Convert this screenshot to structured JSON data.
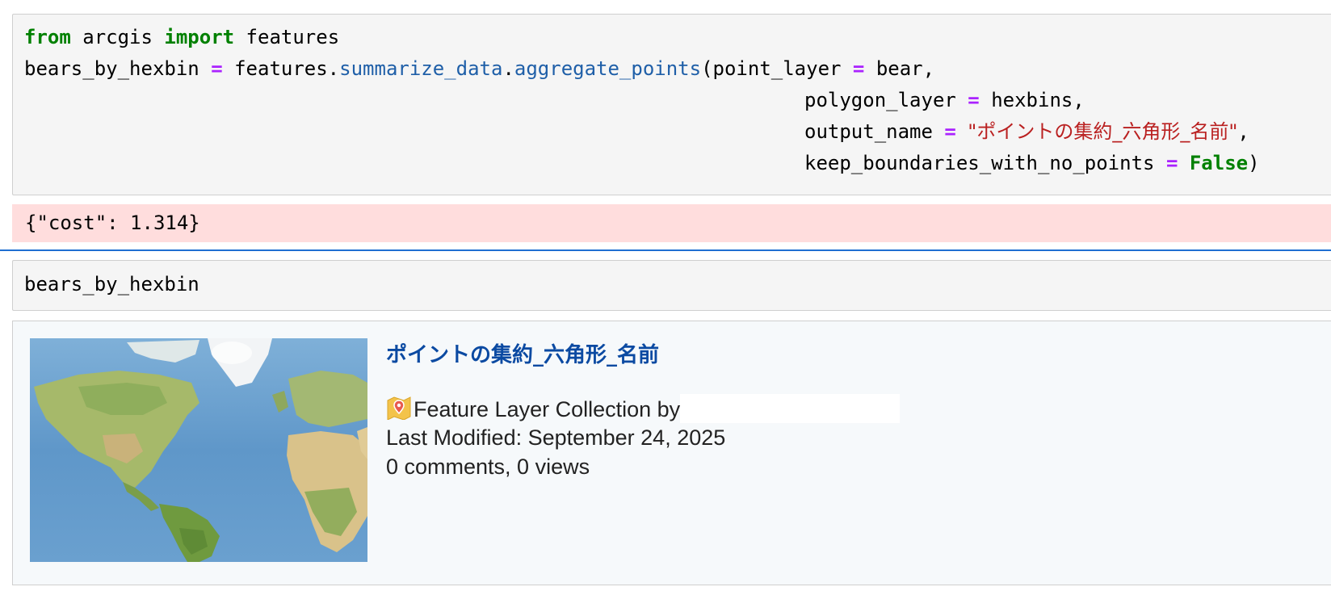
{
  "cell1": {
    "line1": {
      "kw1": "from",
      "mod": " arcgis ",
      "kw2": "import",
      "rest": " features"
    },
    "line2": {
      "var": "bears_by_hexbin ",
      "eq": "=",
      "obj": " features.",
      "fn1": "summarize_data",
      "dot": ".",
      "fn2": "aggregate_points",
      "args": "(point_layer ",
      "eq2": "=",
      "val": " bear,"
    },
    "line3": {
      "arg": "polygon_layer ",
      "eq": "=",
      "val": " hexbins,"
    },
    "line4": {
      "arg": "output_name ",
      "eq": "=",
      "val": " ",
      "str": "\"ポイントの集約_六角形_名前\"",
      "tail": ","
    },
    "line5": {
      "arg": "keep_boundaries_with_no_points ",
      "eq": "=",
      "val": " ",
      "kw": "False",
      "tail": ")"
    }
  },
  "stderr_text": "{\"cost\": 1.314}",
  "cell2": {
    "code": "bears_by_hexbin"
  },
  "item": {
    "title": "ポイントの集約_六角形_名前",
    "type_label": "Feature Layer Collection by",
    "last_modified": "Last Modified: September 24, 2025",
    "stats": "0 comments, 0 views"
  },
  "icons": {
    "layer": "feature-layer-icon",
    "thumbnail": "world-map-thumbnail"
  },
  "colors": {
    "keyword": "#008000",
    "operator": "#aa22ff",
    "function": "#1f5fa8",
    "string": "#ba2121",
    "title": "#0b4aa2",
    "stderr_bg": "#ffdddd",
    "divider": "#1f6fd1"
  }
}
